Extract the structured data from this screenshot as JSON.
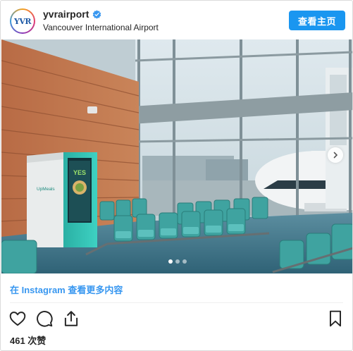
{
  "header": {
    "username": "yvrairport",
    "location": "Vancouver International Airport",
    "view_profile_label": "查看主页",
    "avatar_text": "YVR"
  },
  "post": {
    "image_alt": "Airport gate lounge with teal seating and UpMeals vending kiosk by large windows with aircraft outside",
    "kiosk_brand": "UpMeals",
    "kiosk_screen_text": "YES",
    "carousel": {
      "slides": 3,
      "active_index": 0
    }
  },
  "footer": {
    "more_link": "在 Instagram 查看更多内容",
    "likes": "461 次赞"
  },
  "colors": {
    "primary_button": "#1a96f0",
    "link": "#3897f0",
    "verified": "#3897f0",
    "seat_teal": "#3fa3a0",
    "kiosk_teal": "#2cc3b5"
  },
  "icons": [
    "verified-badge-icon",
    "heart-icon",
    "comment-icon",
    "share-icon",
    "bookmark-icon",
    "chevron-right-icon"
  ]
}
